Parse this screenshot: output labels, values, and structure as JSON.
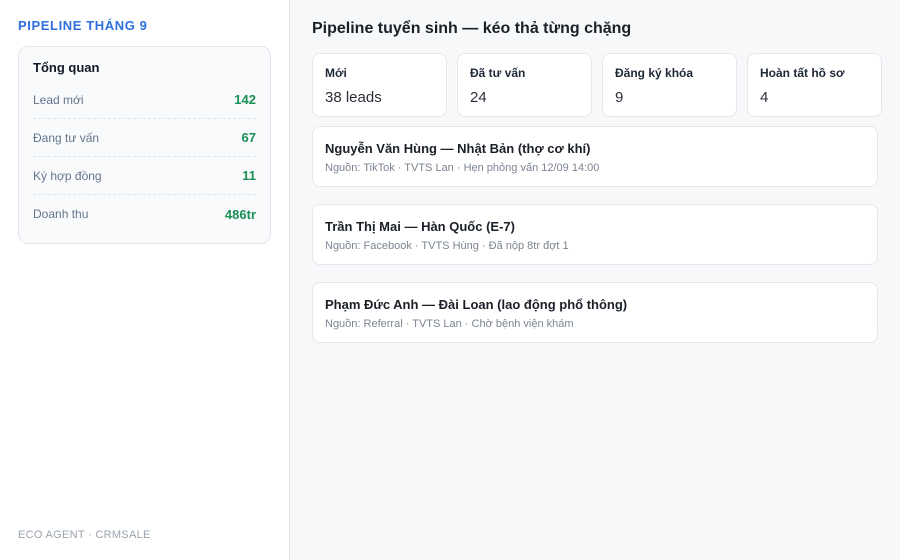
{
  "sidebar": {
    "brand": "PIPELINE THÁNG 9",
    "overview": {
      "title": "Tổng quan",
      "stats": [
        {
          "label": "Lead mới",
          "value": "142"
        },
        {
          "label": "Đang tư vấn",
          "value": "67"
        },
        {
          "label": "Ký hợp đồng",
          "value": "11"
        },
        {
          "label": "Doanh thu",
          "value": "486tr"
        }
      ]
    },
    "footer": "ECO AGENT · CRMSALE"
  },
  "main": {
    "title": "Pipeline tuyển sinh — kéo thả từng chặng",
    "stages": [
      {
        "name": "Mới",
        "count": "38 leads"
      },
      {
        "name": "Đã tư vấn",
        "count": "24"
      },
      {
        "name": "Đăng ký khóa",
        "count": "9"
      },
      {
        "name": "Hoàn tất hồ sơ",
        "count": "4"
      }
    ],
    "deals": [
      {
        "title": "Nguyễn Văn Hùng — Nhật Bản (thợ cơ khí)",
        "meta": "Nguồn: TikTok · TVTS Lan · Hẹn phỏng vấn 12/09 14:00"
      },
      {
        "title": "Trần Thị Mai — Hàn Quốc (E-7)",
        "meta": "Nguồn: Facebook · TVTS Hùng · Đã nộp 8tr đợt 1"
      },
      {
        "title": "Phạm Đức Anh — Đài Loan (lao động phổ thông)",
        "meta": "Nguồn: Referral · TVTS Lan · Chờ bệnh viện khám"
      }
    ]
  },
  "colors": {
    "accent": "#2f6fde",
    "stat_value": "#1b8f54"
  }
}
